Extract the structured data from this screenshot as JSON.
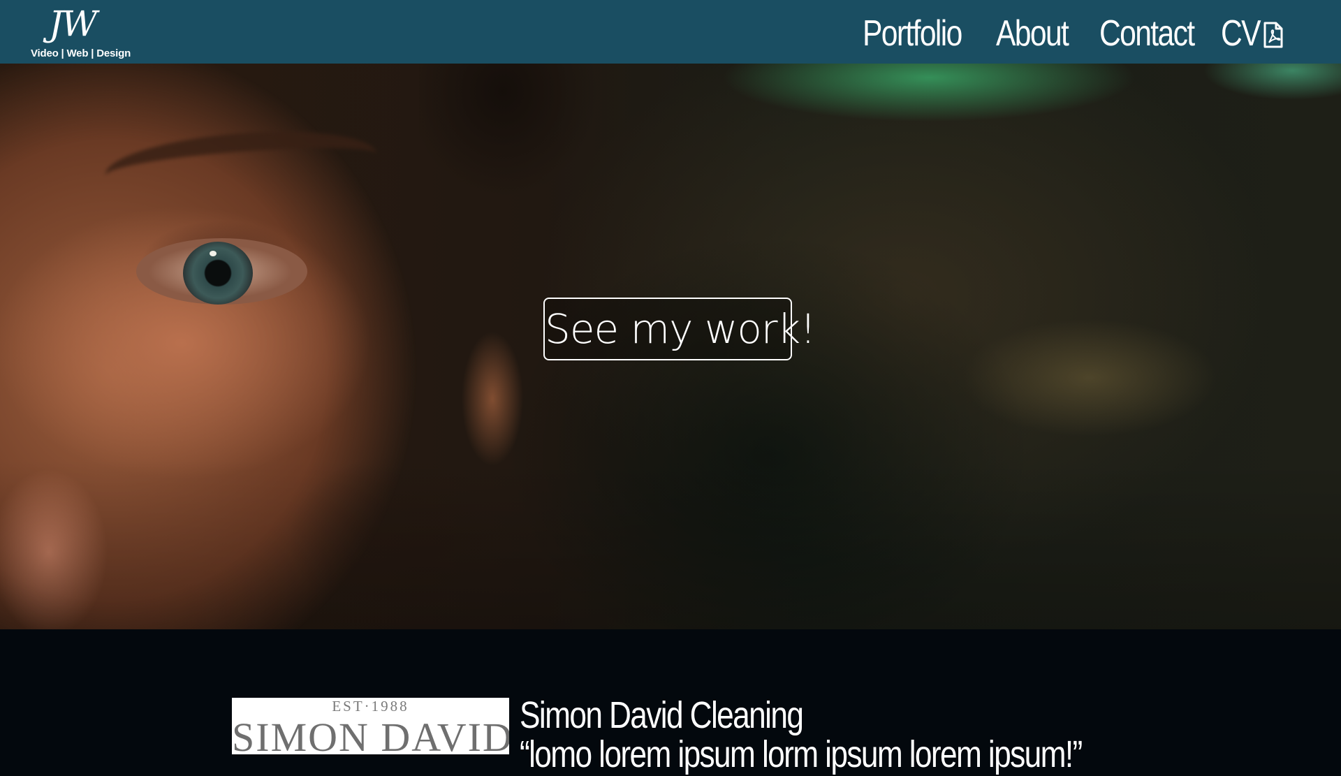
{
  "header": {
    "logo_mark": "JW",
    "logo_tagline": "Video | Web | Design",
    "nav": [
      {
        "label": "Portfolio"
      },
      {
        "label": "About"
      },
      {
        "label": "Contact"
      },
      {
        "label": "CV"
      }
    ],
    "cv_icon": "pdf-file-icon"
  },
  "hero": {
    "cta_label": "See my work!"
  },
  "portfolio": {
    "projects": [
      {
        "thumb_est": "EST·1988",
        "thumb_name": "SIMON DAVID",
        "title": "Simon David Cleaning",
        "quote": "“lomo lorem ipsum   lorm ipsum    lorem  ipsum!”"
      }
    ]
  },
  "colors": {
    "header_bg": "#1a4e62",
    "page_bg": "#03080d",
    "text": "#ffffff"
  }
}
